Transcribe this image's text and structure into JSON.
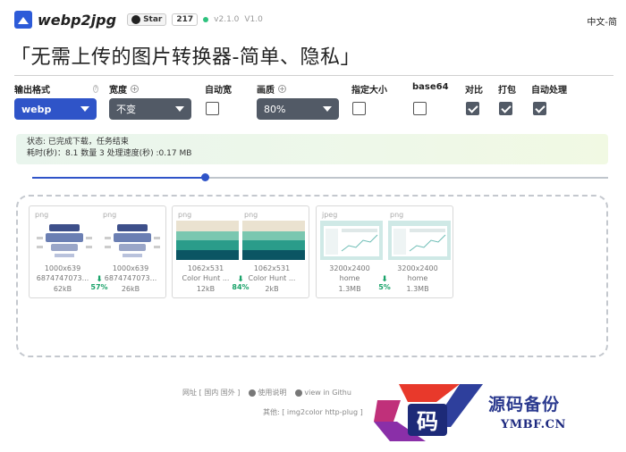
{
  "header": {
    "brand": "webp2jpg",
    "github_label": "Star",
    "star_count": "217",
    "version": "v2.1.0",
    "sub_version": "V1.0",
    "language": "中文-简",
    "slogan": "「无需上传的图片转换器-简单、隐私」"
  },
  "options": {
    "output_format": {
      "label": "输出格式",
      "value": "webp"
    },
    "width": {
      "label": "宽度",
      "value": "不变"
    },
    "auto_width": {
      "label": "自动宽",
      "checked": false
    },
    "quality": {
      "label": "画质",
      "value": "80%"
    },
    "fixed_size": {
      "label": "指定大小",
      "checked": false
    },
    "base64": {
      "label": "base64",
      "checked": false
    },
    "compare": {
      "label": "对比",
      "checked": true
    },
    "pack": {
      "label": "打包",
      "checked": true
    },
    "auto_process": {
      "label": "自动处理",
      "checked": true
    }
  },
  "status": {
    "line1": "状态: 已完成下载，任务结束",
    "line2": "耗时(秒)：8.1 数量 3 处理速度(秒) :0.17 MB"
  },
  "progress": {
    "value": 0.3
  },
  "cards": [
    {
      "before": {
        "format": "png",
        "dims": "1000x639",
        "name": "6874747073...",
        "size": "62kB"
      },
      "after": {
        "format": "png",
        "dims": "1000x639",
        "name": "6874747073...",
        "size": "26kB"
      },
      "saving": "57%"
    },
    {
      "before": {
        "format": "png",
        "dims": "1062x531",
        "name": "Color Hunt ...",
        "size": "12kB"
      },
      "after": {
        "format": "png",
        "dims": "1062x531",
        "name": "Color Hunt ...",
        "size": "2kB"
      },
      "saving": "84%"
    },
    {
      "before": {
        "format": "jpeg",
        "dims": "3200x2400",
        "name": "home",
        "size": "1.3MB"
      },
      "after": {
        "format": "png",
        "dims": "3200x2400",
        "name": "home",
        "size": "1.3MB"
      },
      "saving": "5%"
    }
  ],
  "footer": {
    "site": "网址 [ 国内  国外 ]",
    "docs": "使用说明",
    "github": "view in Githu",
    "other": "其他: [ img2color  http-plug ]"
  },
  "watermark": {
    "title": "源码备份",
    "domain": "YMBF.CN",
    "glyph": "码"
  },
  "colors": {
    "accent": "#2f54c8",
    "select_dark": "#525a66",
    "saving_green": "#1aa36a"
  }
}
